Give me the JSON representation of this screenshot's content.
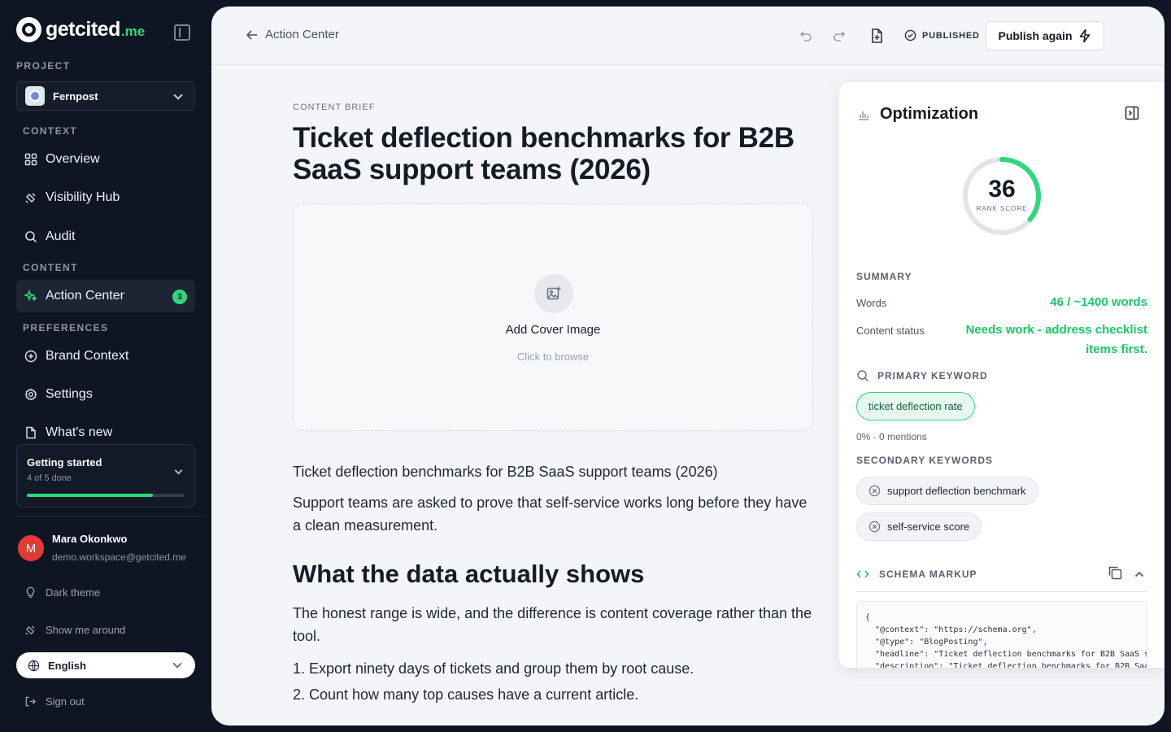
{
  "brand": {
    "name": "getcited",
    "suffix": ".me"
  },
  "sidebar": {
    "project_label": "PROJECT",
    "project_name": "Fernpost",
    "sections": {
      "context": "CONTEXT",
      "content": "CONTENT",
      "preferences": "PREFERENCES"
    },
    "items": {
      "overview": "Overview",
      "visibility_hub": "Visibility Hub",
      "audit": "Audit",
      "action_center": "Action Center",
      "action_center_badge": "3",
      "brand_context": "Brand Context",
      "settings": "Settings",
      "whats_new": "What's new"
    },
    "getting_started": {
      "title": "Getting started",
      "progress_text": "4 of 5 done",
      "progress_fraction": 0.8
    },
    "user": {
      "initial": "M",
      "name": "Mara Okonkwo",
      "email": "demo.workspace@getcited.me"
    },
    "dark_theme": "Dark theme",
    "show_me_around": "Show me around",
    "language": "English",
    "sign_out": "Sign out"
  },
  "topbar": {
    "back_label": "Action Center",
    "status": "PUBLISHED",
    "publish_button": "Publish again"
  },
  "editor": {
    "brief_label": "CONTENT BRIEF",
    "title": "Ticket deflection benchmarks for B2B SaaS support teams (2026)",
    "cover_title": "Add Cover Image",
    "cover_sub": "Click to browse",
    "paragraph_1": "Ticket deflection benchmarks for B2B SaaS support teams (2026)",
    "paragraph_2": "Support teams are asked to prove that self-service works long before they have a clean measurement.",
    "heading_2": "What the data actually shows",
    "paragraph_3": "The honest range is wide, and the difference is content coverage rather than the tool.",
    "list": [
      "Export ninety days of tickets and group them by root cause.",
      "Count how many top causes have a current article."
    ]
  },
  "optimization": {
    "title": "Optimization",
    "score": "36",
    "score_value": 36,
    "score_max": 100,
    "score_label": "RANK SCORE",
    "summary_label": "SUMMARY",
    "words_label": "Words",
    "words_value": "46 / ~1400 words",
    "status_label": "Content status",
    "status_value_line1": "Needs work - address checklist",
    "status_value_line2": "items first.",
    "primary_label": "PRIMARY KEYWORD",
    "primary_keyword": "ticket deflection rate",
    "primary_mentions": "0% · 0 mentions",
    "secondary_label": "SECONDARY KEYWORDS",
    "secondary_keywords": [
      "support deflection benchmark",
      "self-service score"
    ],
    "schema_label": "SCHEMA MARKUP",
    "schema_code": "{\n  \"@context\": \"https://schema.org\",\n  \"@type\": \"BlogPosting\",\n  \"headline\": \"Ticket deflection benchmarks for B2B SaaS support teams (2026)\",\n  \"description\": \"Ticket deflection benchmarks for B2B SaaS support teams (2026)\"\n}",
    "colors": {
      "accent": "#2fd87a",
      "track": "#e2e4e9"
    }
  }
}
